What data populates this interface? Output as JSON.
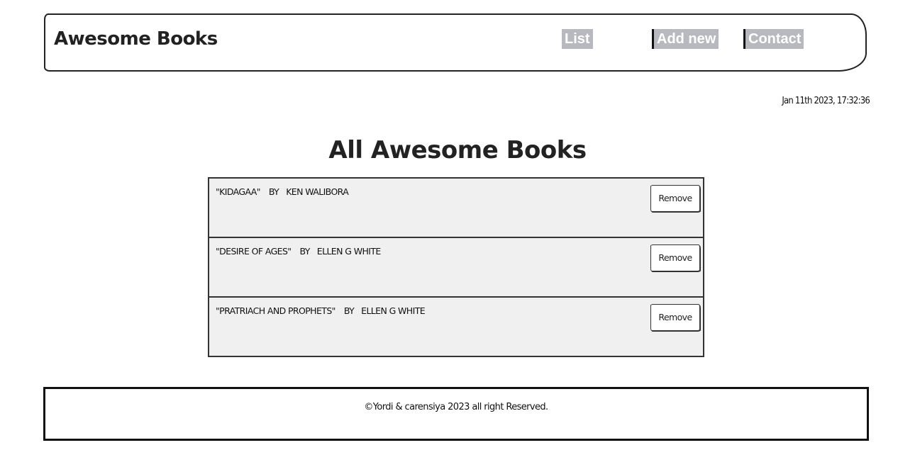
{
  "header": {
    "brand": "Awesome Books",
    "nav": [
      {
        "label": "List"
      },
      {
        "label": "Add new"
      },
      {
        "label": "Contact"
      }
    ]
  },
  "datetime": "Jan 11th 2023, 17:32:36",
  "main": {
    "title": "All Awesome Books",
    "by_label": "By",
    "remove_label": "Remove",
    "books": [
      {
        "title": "\"Kidagaa\"",
        "author": "Ken Walibora"
      },
      {
        "title": "\"Desire of Ages\"",
        "author": "Ellen G White"
      },
      {
        "title": "\"Pratriach and Prophets\"",
        "author": "Ellen G White"
      }
    ]
  },
  "footer": {
    "text": "©Yordi & carensiya 2023 all right Reserved."
  }
}
